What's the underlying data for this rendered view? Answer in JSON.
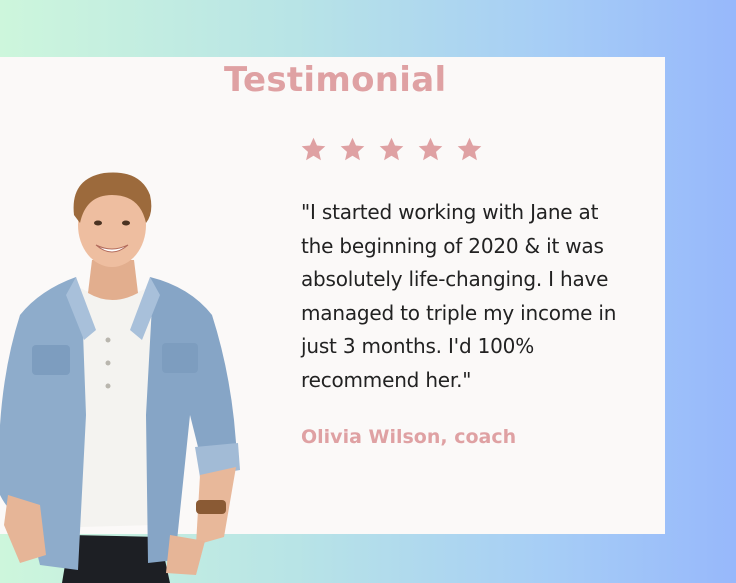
{
  "heading": "Testimonial",
  "rating": {
    "value": 5,
    "max": 5
  },
  "quote": "\"I started working with Jane at the beginning of 2020 & it was absolutely life-changing. I have managed to triple my income in just 3 months. I'd 100% recommend her.\"",
  "author": "Olivia Wilson, coach",
  "colors": {
    "accent": "#dfa1a3",
    "card": "#fbf9f8",
    "text": "#222222",
    "gradient_left": "#cdf6dc",
    "gradient_right": "#97b8fb"
  },
  "icons": {
    "star": "star-icon"
  }
}
